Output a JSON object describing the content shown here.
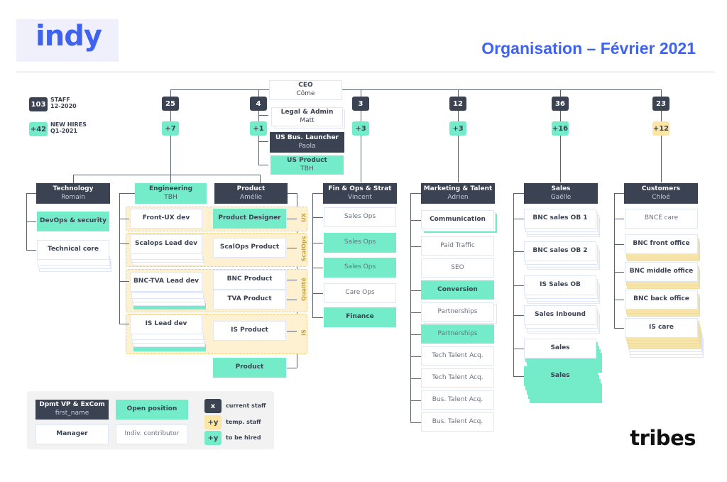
{
  "header": {
    "logo": "indy",
    "title": "Organisation – Février 2021"
  },
  "kpis": {
    "staff": {
      "value": "103",
      "label1": "STAFF",
      "label2": "12-2020"
    },
    "hires": {
      "value": "+42",
      "label1": "NEW HIRES",
      "label2": "Q1-2021"
    }
  },
  "ceo": {
    "title": "CEO",
    "name": "Côme"
  },
  "departments": [
    {
      "id": "technology",
      "title": "Technology",
      "name": "Romain",
      "staff": "25",
      "hires": "+7",
      "hires_type": "to_be_hired"
    },
    {
      "id": "ceo-office",
      "staff": "4",
      "hires": "+1",
      "hires_type": "to_be_hired"
    },
    {
      "id": "fin-ops",
      "title": "Fin & Ops & Strat",
      "name": "Vincent",
      "staff": "3",
      "hires": "+3",
      "hires_type": "to_be_hired"
    },
    {
      "id": "marketing",
      "title": "Marketing & Talent",
      "name": "Adrien",
      "staff": "12",
      "hires": "+3",
      "hires_type": "to_be_hired"
    },
    {
      "id": "sales",
      "title": "Sales",
      "name": "Gaëlle",
      "staff": "36",
      "hires": "+16",
      "hires_type": "to_be_hired"
    },
    {
      "id": "customers",
      "title": "Customers",
      "name": "Chloé",
      "staff": "23",
      "hires": "+12",
      "hires_type": "temp_staff"
    }
  ],
  "ceo_office": [
    {
      "title": "Legal & Admin",
      "name": "Matt",
      "type": "manager"
    },
    {
      "title": "US Bus. Launcher",
      "name": "Paola",
      "type": "vp"
    },
    {
      "title": "US Product",
      "name": "TBH",
      "type": "open"
    }
  ],
  "technology": {
    "teams": [
      {
        "label": "DevOps & security",
        "type": "open"
      },
      {
        "label": "Technical core",
        "type": "manager"
      }
    ],
    "engineering": {
      "title": "Engineering",
      "name": "TBH"
    },
    "product": {
      "title": "Product",
      "name": "Amélie"
    },
    "squads": [
      {
        "group": "UX",
        "dev": "Front-UX dev",
        "product": [
          "Product Designer"
        ]
      },
      {
        "group": "ScalOps",
        "dev": "Scalops Lead dev",
        "product": [
          "ScalOps Product"
        ]
      },
      {
        "group": "Qualité",
        "dev": "BNC-TVA Lead dev",
        "product": [
          "BNC Product",
          "TVA Product"
        ]
      },
      {
        "group": "IS",
        "dev": "IS Lead dev",
        "product": [
          "IS Product"
        ]
      }
    ],
    "extra_product": "Product"
  },
  "fin_ops": [
    {
      "label": "Sales Ops",
      "type": "contributor"
    },
    {
      "label": "Sales Ops",
      "type": "open-contributor"
    },
    {
      "label": "Sales Ops",
      "type": "open-contributor"
    },
    {
      "label": "Care Ops",
      "type": "contributor"
    },
    {
      "label": "Finance",
      "type": "open"
    }
  ],
  "marketing": [
    {
      "label": "Communication",
      "type": "manager"
    },
    {
      "label": "Paid Traffic",
      "type": "contributor"
    },
    {
      "label": "SEO",
      "type": "contributor"
    },
    {
      "label": "Conversion",
      "type": "open"
    },
    {
      "label": "Partnerships",
      "type": "contributor"
    },
    {
      "label": "Partnerships",
      "type": "open-contributor"
    },
    {
      "label": "Tech Talent Acq.",
      "type": "contributor"
    },
    {
      "label": "Tech Talent Acq.",
      "type": "contributor"
    },
    {
      "label": "Bus. Talent Acq.",
      "type": "contributor"
    },
    {
      "label": "Bus. Talent Acq.",
      "type": "contributor"
    }
  ],
  "sales": [
    {
      "label": "BNC sales OB 1"
    },
    {
      "label": "BNC sales OB 2"
    },
    {
      "label": "IS Sales OB"
    },
    {
      "label": "Sales Inbound"
    },
    {
      "label": "Sales"
    },
    {
      "label": "Sales"
    }
  ],
  "customers": [
    {
      "label": "BNCE care"
    },
    {
      "label": "BNC front office"
    },
    {
      "label": "BNC middle office"
    },
    {
      "label": "BNC back office"
    },
    {
      "label": "IS care"
    }
  ],
  "legend": {
    "vp": {
      "title": "Dpmt VP & ExCom",
      "name": "first_name"
    },
    "open": "Open position",
    "manager": "Manager",
    "contributor": "Indiv. contributor",
    "badges": [
      {
        "symbol": "x",
        "label": "current staff"
      },
      {
        "symbol": "+y",
        "label": "temp. staff"
      },
      {
        "symbol": "+y",
        "label": "to be hired"
      }
    ]
  },
  "footer": {
    "brand": "tribes"
  },
  "colors": {
    "brand_blue": "#3e63f0",
    "dark": "#3b4252",
    "open_green": "#74ecc9",
    "temp_yellow": "#fbe6a6",
    "group_bg": "#fdf1d2"
  }
}
